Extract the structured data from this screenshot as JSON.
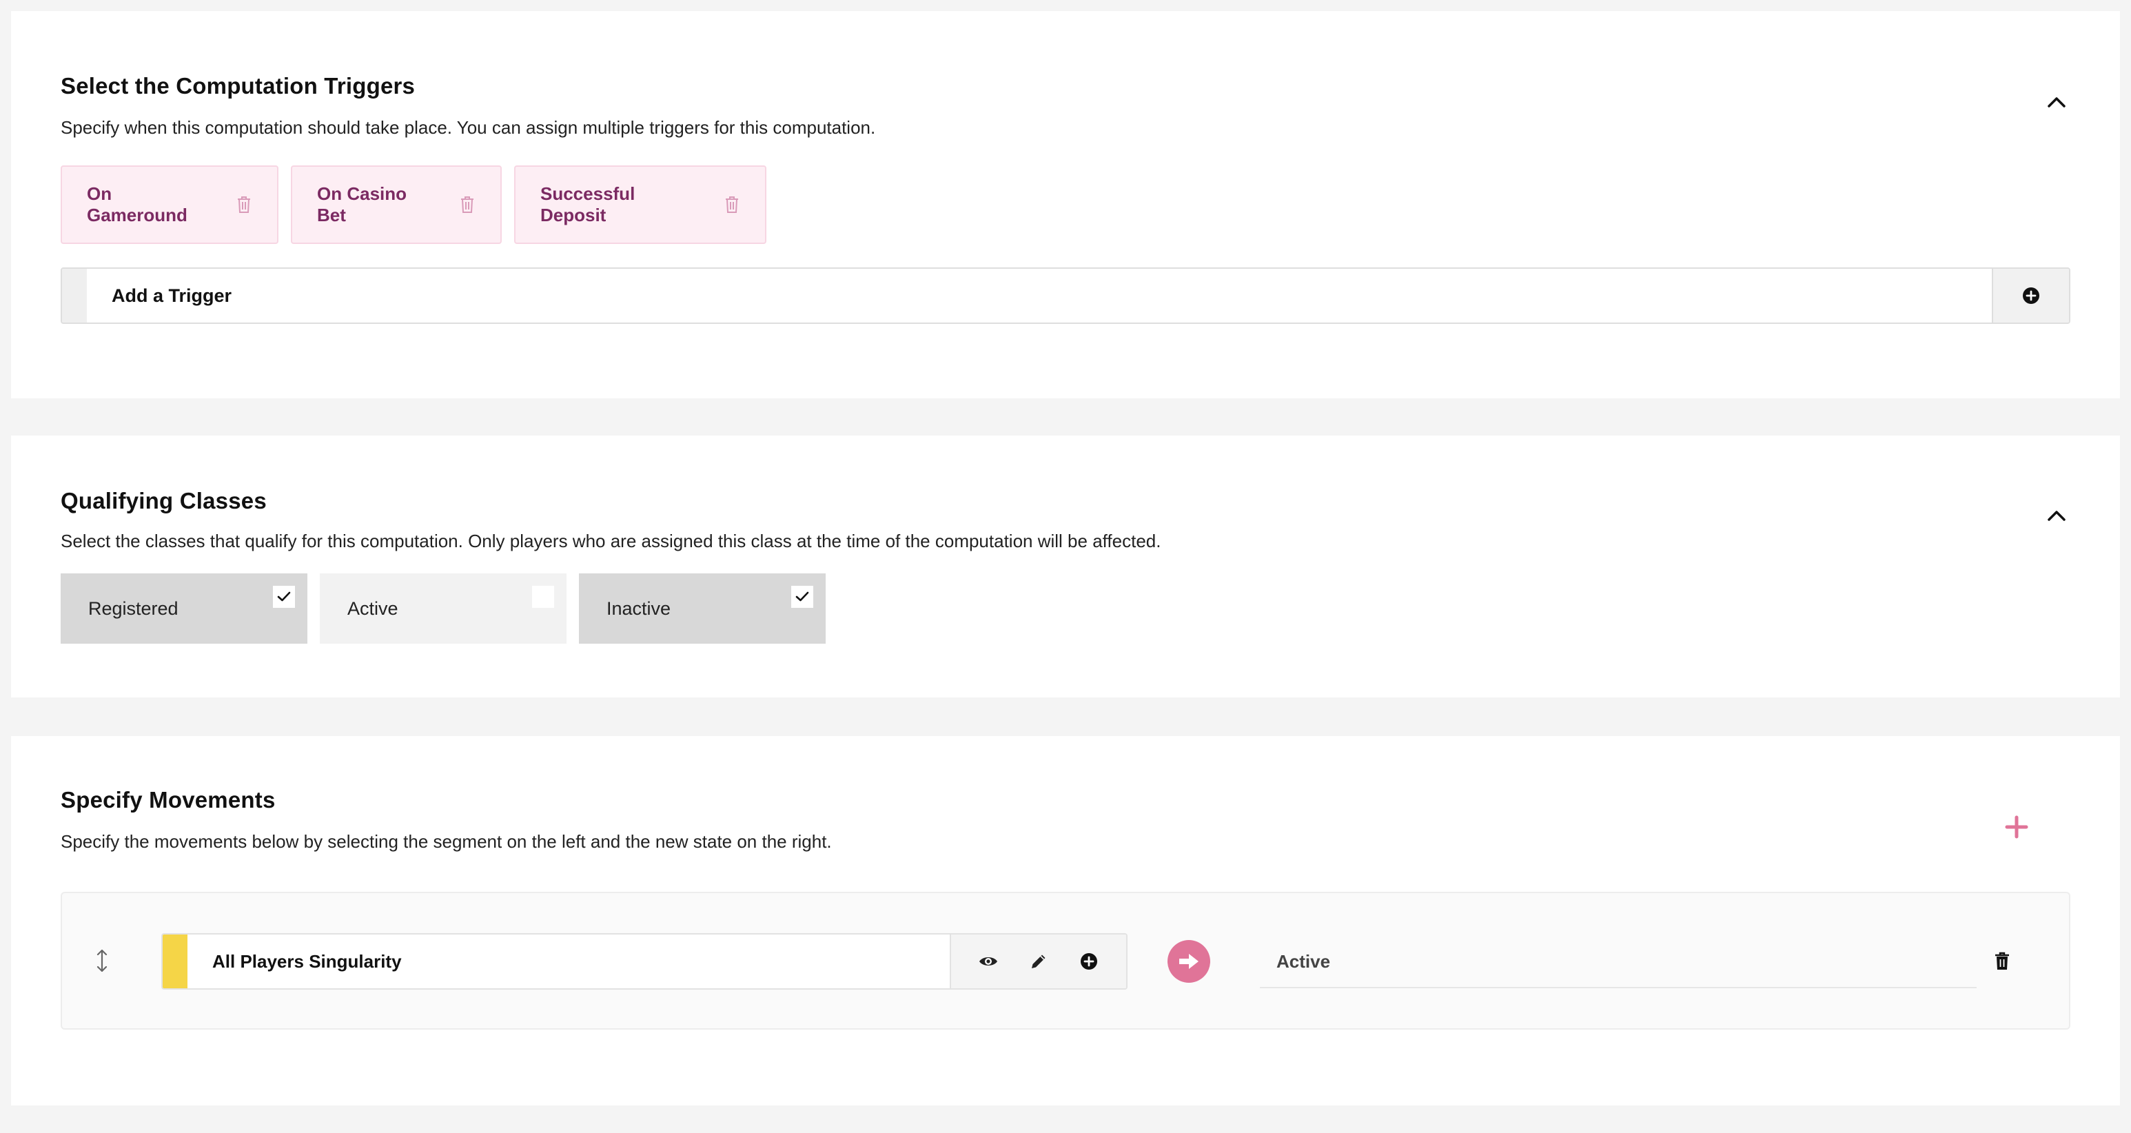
{
  "triggers_section": {
    "title": "Select the Computation Triggers",
    "description": "Specify when this computation should take place. You can assign multiple triggers for this computation.",
    "chips": [
      {
        "label": "On Gameround"
      },
      {
        "label": "On Casino Bet"
      },
      {
        "label": "Successful Deposit"
      }
    ],
    "add_trigger_label": "Add a Trigger"
  },
  "classes_section": {
    "title": "Qualifying Classes",
    "description": "Select the classes that qualify for this computation. Only players who are assigned this class at the time of the computation will be affected.",
    "classes": [
      {
        "label": "Registered",
        "checked": true
      },
      {
        "label": "Active",
        "checked": false
      },
      {
        "label": "Inactive",
        "checked": true
      }
    ]
  },
  "movements_section": {
    "title": "Specify Movements",
    "description": "Specify the movements below by selecting the segment on the left and the new state on the right.",
    "movements": [
      {
        "segment": "All Players Singularity",
        "segment_color": "#f5d547",
        "target_state": "Active"
      }
    ]
  },
  "colors": {
    "accent_pink": "#e07498",
    "chip_bg": "#fdeef4",
    "chip_text": "#7b2a62",
    "checked_bg": "#d8d8d8",
    "page_bg": "#f4f4f4"
  },
  "icons": {
    "collapse": "chevron-up-icon",
    "remove": "trash-icon",
    "add": "plus-circle-icon",
    "view": "eye-icon",
    "edit": "pencil-icon",
    "drag": "drag-vertical-icon",
    "arrow": "arrow-right-icon"
  }
}
